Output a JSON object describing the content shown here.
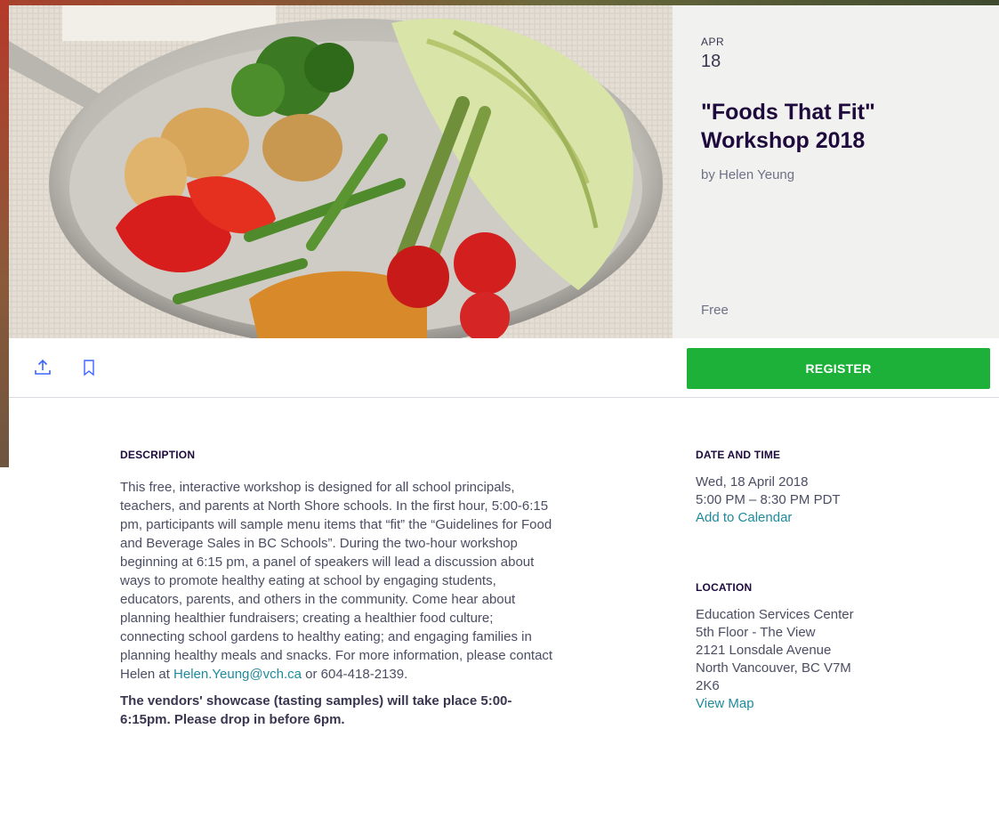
{
  "event": {
    "month": "APR",
    "day": "18",
    "title": "\"Foods That Fit\" Workshop 2018",
    "organizer": "by Helen Yeung",
    "price": "Free"
  },
  "actions": {
    "share_icon": "share-upload-icon",
    "save_icon": "bookmark-icon",
    "register_label": "REGISTER"
  },
  "description": {
    "heading": "DESCRIPTION",
    "body": "This free, interactive workshop is designed for all school principals, teachers, and parents at North Shore schools. In the first hour, 5:00-6:15 pm, participants will sample menu items that “fit” the “Guidelines for Food and Beverage Sales in BC Schools”. During the two-hour workshop beginning at 6:15 pm, a panel of speakers will lead a discussion about ways to promote healthy eating at school by engaging students, educators, parents, and others in the community. Come hear about planning healthier fundraisers; creating a healthier food culture; connecting school gardens to healthy eating; and engaging families in planning healthy meals and snacks. For more information, please contact Helen at",
    "email": "Helen.Yeung@vch.ca",
    "phone_text": " or 604-418-2139.",
    "showcase": "The vendors' showcase (tasting samples) will take place 5:00-6:15pm. Please drop in before 6pm."
  },
  "date_time": {
    "heading": "DATE AND TIME",
    "date": "Wed, 18 April 2018",
    "time": "5:00 PM – 8:30 PM PDT",
    "calendar_link": "Add to Calendar"
  },
  "location": {
    "heading": "LOCATION",
    "line1": "Education Services Center",
    "line2": "5th Floor - The View",
    "line3": "2121 Lonsdale Avenue",
    "line4": "North Vancouver, BC V7M",
    "line5": "2K6",
    "map_link": "View Map"
  },
  "colors": {
    "register": "#1db13a",
    "link": "#1f8a9c",
    "card_bg": "#f1f1ef"
  }
}
